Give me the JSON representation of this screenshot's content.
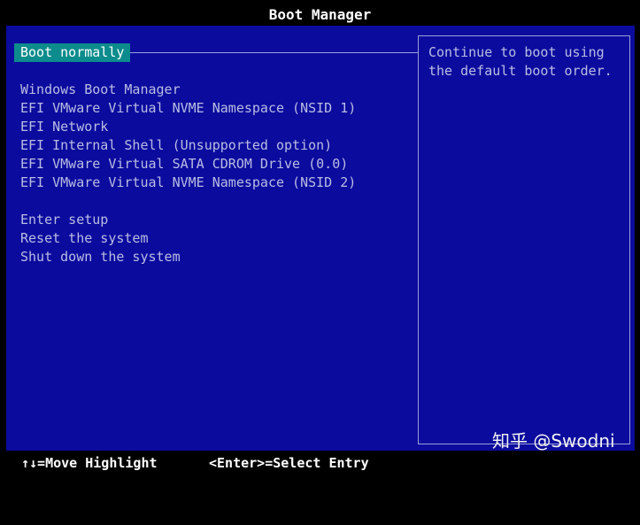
{
  "header": {
    "title": "Boot Manager"
  },
  "menu": {
    "selected": "Boot normally",
    "boot_entries": [
      "Windows Boot Manager",
      "EFI VMware Virtual NVME Namespace (NSID 1)",
      "EFI Network",
      "EFI Internal Shell (Unsupported option)",
      "EFI VMware Virtual SATA CDROM Drive (0.0)",
      "EFI VMware Virtual NVME Namespace (NSID 2)"
    ],
    "actions": [
      "Enter setup",
      "Reset the system",
      "Shut down the system"
    ]
  },
  "help": {
    "lines": [
      "Continue to boot using",
      "the default boot order."
    ]
  },
  "footer": {
    "move_hint": "↑↓=Move Highlight",
    "select_hint": "<Enter>=Select Entry"
  },
  "watermark": "知乎 @Swodni",
  "colors": {
    "background": "#0b0b9e",
    "highlight": "#0c8c8c",
    "text": "#b9bde3"
  }
}
